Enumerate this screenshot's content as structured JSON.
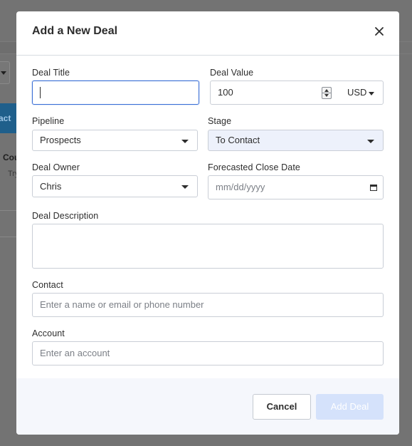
{
  "background": {
    "button_fragment": "tact",
    "text_fragment_1": "Cou",
    "text_fragment_2": "Try"
  },
  "modal": {
    "title": "Add a New Deal",
    "close_icon": "close-icon"
  },
  "form": {
    "deal_title": {
      "label": "Deal Title",
      "value": ""
    },
    "deal_value": {
      "label": "Deal Value",
      "value": "100",
      "currency": "USD"
    },
    "pipeline": {
      "label": "Pipeline",
      "value": "Prospects"
    },
    "stage": {
      "label": "Stage",
      "value": "To Contact"
    },
    "deal_owner": {
      "label": "Deal Owner",
      "value": "Chris"
    },
    "forecasted_close_date": {
      "label": "Forecasted Close Date",
      "placeholder": "mm/dd/yyyy"
    },
    "deal_description": {
      "label": "Deal Description",
      "value": ""
    },
    "contact": {
      "label": "Contact",
      "placeholder": "Enter a name or email or phone number"
    },
    "account": {
      "label": "Account",
      "placeholder": "Enter an account"
    }
  },
  "footer": {
    "cancel_label": "Cancel",
    "add_label": "Add Deal"
  },
  "colors": {
    "focus_border": "#3b6fd6",
    "stage_bg": "#edf1fb",
    "add_button_bg": "#d5e2fb",
    "footer_bg": "#f5f7fc",
    "overlay": "#737373"
  }
}
